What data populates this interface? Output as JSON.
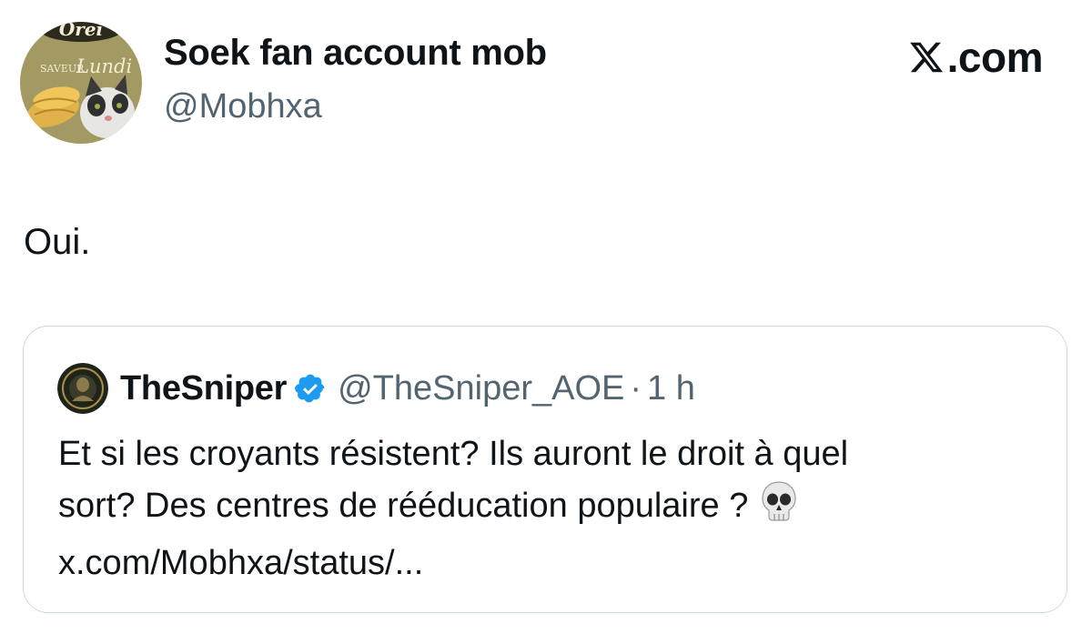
{
  "author": {
    "display_name": "Soek fan account mob",
    "handle": "@Mobhxa",
    "avatar_icon": "chips-bag-cat-avatar",
    "avatar_text_brand": "Orei",
    "avatar_text_top": "SAVEUR",
    "avatar_text_bottom": "Lundi"
  },
  "brand": {
    "label": ".com",
    "icon": "x-logo-icon"
  },
  "tweet": {
    "text": "Oui."
  },
  "quote": {
    "display_name": "TheSniper",
    "verified_icon": "verified-badge-icon",
    "verified_color": "#1d9bf0",
    "handle": "@TheSniper_AOE",
    "separator": "·",
    "time": "1 h",
    "lines": [
      "Et si les croyants résistent? Ils auront le droit à quel",
      "sort? Des centres de rééducation populaire ?",
      "x.com/Mobhxa/status/..."
    ],
    "emoji_icon": "skull-icon"
  }
}
